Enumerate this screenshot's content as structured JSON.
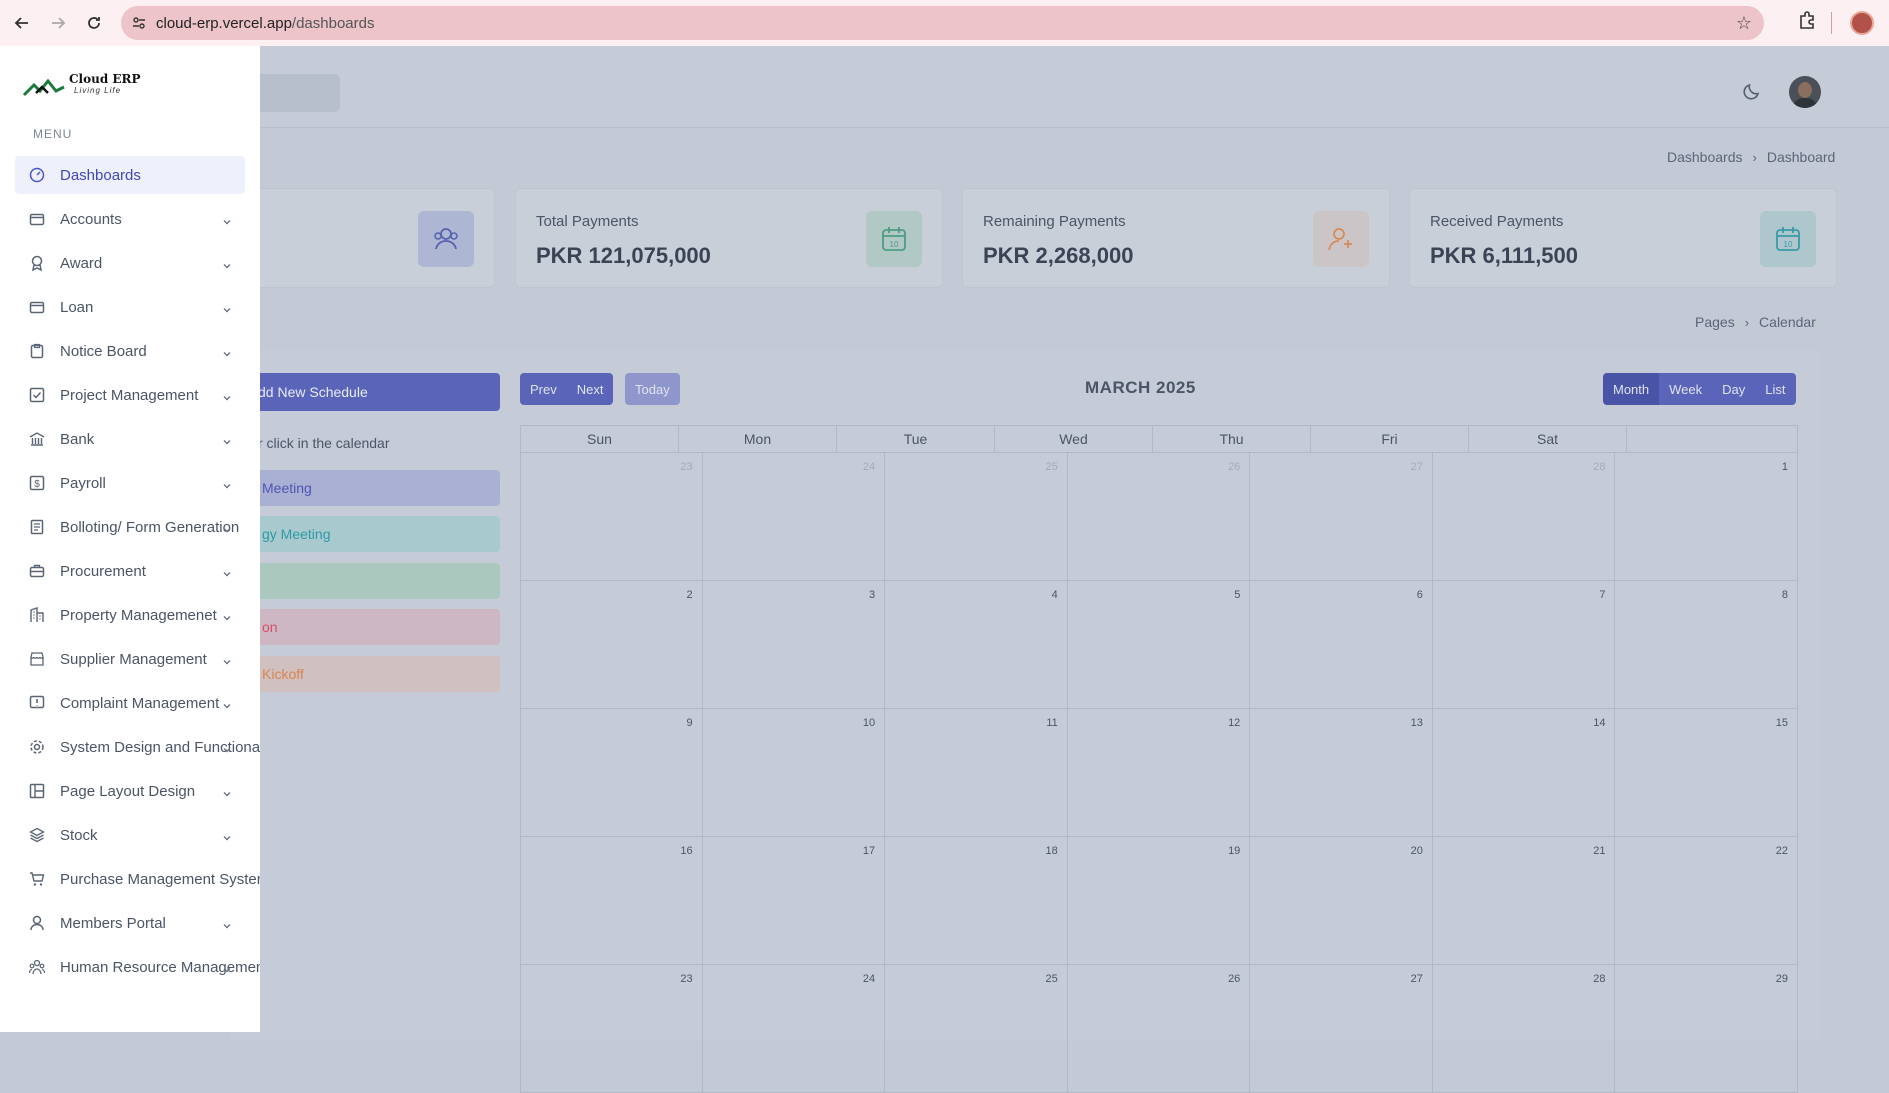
{
  "browser": {
    "url_host": "cloud-erp.vercel.app",
    "url_path": "/dashboards"
  },
  "header": {
    "breadcrumb_root": "Dashboards",
    "breadcrumb_current": "Dashboard"
  },
  "stats": [
    {
      "label": "Total Payments",
      "value": "PKR 121,075,000",
      "accent": "#5cae95"
    },
    {
      "label": "Remaining Payments",
      "value": "PKR 2,268,000",
      "accent": "#e29a6a"
    },
    {
      "label": "Received Payments",
      "value": "PKR 6,111,500",
      "accent": "#43a7b5"
    }
  ],
  "calendar": {
    "breadcrumb_root": "Pages",
    "breadcrumb_current": "Calendar",
    "add_button": "dd New Schedule",
    "drag_hint": "r click in the calendar",
    "events": [
      {
        "label": "Meeting",
        "bg": "#a9b0d3",
        "fg": "#4b56b5"
      },
      {
        "label": "gy Meeting",
        "bg": "#a8c9ce",
        "fg": "#2f9aa7"
      },
      {
        "label": "",
        "bg": "#abc8bf",
        "fg": "#3c8f76"
      },
      {
        "label": "on",
        "bg": "#cdb7c2",
        "fg": "#d4506a"
      },
      {
        "label": "Kickoff",
        "bg": "#d0c0bf",
        "fg": "#d9854f"
      }
    ],
    "prev": "Prev",
    "next": "Next",
    "today": "Today",
    "title": "MARCH 2025",
    "views": [
      "Month",
      "Week",
      "Day",
      "List"
    ],
    "days_of_week": [
      "Sun",
      "Mon",
      "Tue",
      "Wed",
      "Thu",
      "Fri",
      "Sat"
    ],
    "weeks": [
      [
        {
          "n": "23",
          "o": true
        },
        {
          "n": "24",
          "o": true
        },
        {
          "n": "25",
          "o": true
        },
        {
          "n": "26",
          "o": true
        },
        {
          "n": "27",
          "o": true
        },
        {
          "n": "28",
          "o": true
        },
        {
          "n": "1",
          "o": false
        }
      ],
      [
        {
          "n": "2"
        },
        {
          "n": "3"
        },
        {
          "n": "4"
        },
        {
          "n": "5"
        },
        {
          "n": "6"
        },
        {
          "n": "7"
        },
        {
          "n": "8"
        }
      ],
      [
        {
          "n": "9"
        },
        {
          "n": "10"
        },
        {
          "n": "11"
        },
        {
          "n": "12"
        },
        {
          "n": "13"
        },
        {
          "n": "14"
        },
        {
          "n": "15"
        }
      ],
      [
        {
          "n": "16"
        },
        {
          "n": "17"
        },
        {
          "n": "18"
        },
        {
          "n": "19"
        },
        {
          "n": "20"
        },
        {
          "n": "21"
        },
        {
          "n": "22"
        }
      ],
      [
        {
          "n": "23"
        },
        {
          "n": "24"
        },
        {
          "n": "25"
        },
        {
          "n": "26"
        },
        {
          "n": "27"
        },
        {
          "n": "28"
        },
        {
          "n": "29"
        }
      ]
    ]
  },
  "sidebar": {
    "logo_title": "Cloud ERP",
    "logo_sub": "Living Life",
    "menu_heading": "MENU",
    "items": [
      {
        "label": "Dashboards",
        "icon": "dashboard-icon",
        "active": true,
        "chevron": false
      },
      {
        "label": "Accounts",
        "icon": "wallet-icon",
        "chevron": true
      },
      {
        "label": "Award",
        "icon": "award-icon",
        "chevron": true
      },
      {
        "label": "Loan",
        "icon": "wallet-icon",
        "chevron": true
      },
      {
        "label": "Notice Board",
        "icon": "clipboard-icon",
        "chevron": true
      },
      {
        "label": "Project Management",
        "icon": "checkbox-icon",
        "chevron": true
      },
      {
        "label": "Bank",
        "icon": "bank-icon",
        "chevron": true
      },
      {
        "label": "Payroll",
        "icon": "dollar-icon",
        "chevron": true
      },
      {
        "label": "Bolloting/ Form Generation",
        "icon": "form-icon",
        "chevron": true
      },
      {
        "label": "Procurement",
        "icon": "briefcase-icon",
        "chevron": true
      },
      {
        "label": "Property Managemenet",
        "icon": "building-icon",
        "chevron": true
      },
      {
        "label": "Supplier Management",
        "icon": "store-icon",
        "chevron": true
      },
      {
        "label": "Complaint Management",
        "icon": "alert-icon",
        "chevron": true
      },
      {
        "label": "System Design and Functiona",
        "icon": "settings-icon",
        "chevron": true
      },
      {
        "label": "Page Layout Design",
        "icon": "layout-icon",
        "chevron": true
      },
      {
        "label": "Stock",
        "icon": "layers-icon",
        "chevron": true
      },
      {
        "label": "Purchase Management Syster",
        "icon": "cart-icon",
        "chevron": false
      },
      {
        "label": "Members Portal",
        "icon": "user-icon",
        "chevron": true
      },
      {
        "label": "Human Resource Managemen",
        "icon": "team-icon",
        "chevron": true
      }
    ]
  }
}
